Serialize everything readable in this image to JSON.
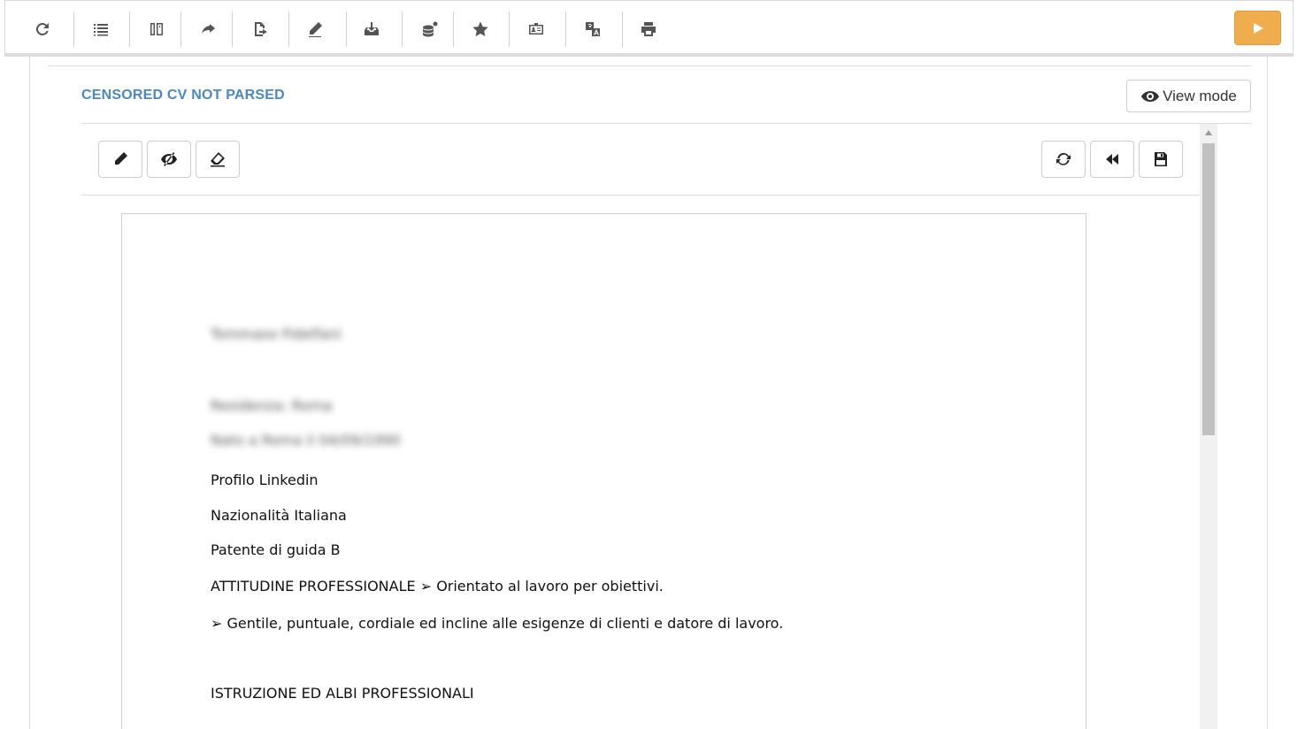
{
  "toolbar": {
    "icons": [
      "refresh-icon",
      "list-icon",
      "columns-icon",
      "share-arrow-icon",
      "export-file-icon",
      "pencil-icon",
      "inbox-download-icon",
      "stack-settings-icon",
      "star-icon",
      "id-card-icon",
      "translate-icon",
      "print-icon",
      "play-icon"
    ]
  },
  "section": {
    "title": "CENSORED CV NOT PARSED",
    "view_mode_label": "View mode"
  },
  "document": {
    "blurred_name": "Tommaso Fidelfani",
    "blurred_residence": "Residenza: Roma",
    "blurred_birth": "Nato a Roma il 04/09/1990",
    "lines": [
      "Profilo Linkedin",
      "Nazionalità Italiana",
      "Patente di guida B",
      "ATTITUDINE PROFESSIONALE   ➢ Orientato al lavoro per obiettivi.",
      "➢ Gentile, puntuale, cordiale ed incline alle esigenze di clienti e datore di lavoro.",
      "ISTRUZIONE ED ALBI PROFESSIONALI"
    ]
  },
  "colors": {
    "accent": "#4a88c4",
    "play_button": "#f0ad4e"
  }
}
